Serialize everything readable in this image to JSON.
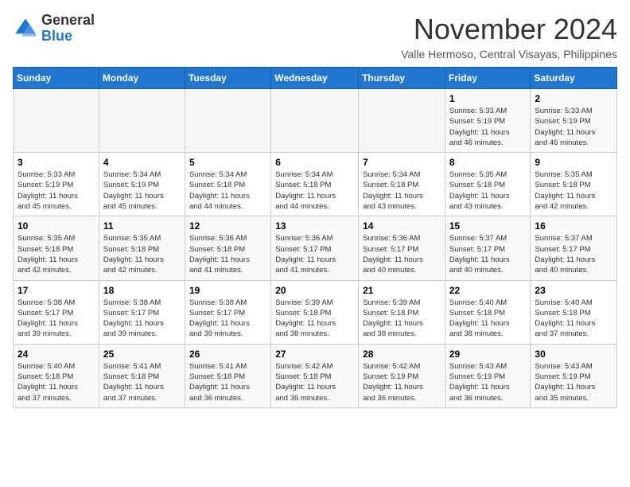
{
  "header": {
    "logo_general": "General",
    "logo_blue": "Blue",
    "month": "November 2024",
    "location": "Valle Hermoso, Central Visayas, Philippines"
  },
  "days_of_week": [
    "Sunday",
    "Monday",
    "Tuesday",
    "Wednesday",
    "Thursday",
    "Friday",
    "Saturday"
  ],
  "weeks": [
    [
      {
        "day": "",
        "info": ""
      },
      {
        "day": "",
        "info": ""
      },
      {
        "day": "",
        "info": ""
      },
      {
        "day": "",
        "info": ""
      },
      {
        "day": "",
        "info": ""
      },
      {
        "day": "1",
        "info": "Sunrise: 5:33 AM\nSunset: 5:19 PM\nDaylight: 11 hours\nand 46 minutes."
      },
      {
        "day": "2",
        "info": "Sunrise: 5:33 AM\nSunset: 5:19 PM\nDaylight: 11 hours\nand 46 minutes."
      }
    ],
    [
      {
        "day": "3",
        "info": "Sunrise: 5:33 AM\nSunset: 5:19 PM\nDaylight: 11 hours\nand 45 minutes."
      },
      {
        "day": "4",
        "info": "Sunrise: 5:34 AM\nSunset: 5:19 PM\nDaylight: 11 hours\nand 45 minutes."
      },
      {
        "day": "5",
        "info": "Sunrise: 5:34 AM\nSunset: 5:18 PM\nDaylight: 11 hours\nand 44 minutes."
      },
      {
        "day": "6",
        "info": "Sunrise: 5:34 AM\nSunset: 5:18 PM\nDaylight: 11 hours\nand 44 minutes."
      },
      {
        "day": "7",
        "info": "Sunrise: 5:34 AM\nSunset: 5:18 PM\nDaylight: 11 hours\nand 43 minutes."
      },
      {
        "day": "8",
        "info": "Sunrise: 5:35 AM\nSunset: 5:18 PM\nDaylight: 11 hours\nand 43 minutes."
      },
      {
        "day": "9",
        "info": "Sunrise: 5:35 AM\nSunset: 5:18 PM\nDaylight: 11 hours\nand 42 minutes."
      }
    ],
    [
      {
        "day": "10",
        "info": "Sunrise: 5:35 AM\nSunset: 5:18 PM\nDaylight: 11 hours\nand 42 minutes."
      },
      {
        "day": "11",
        "info": "Sunrise: 5:35 AM\nSunset: 5:18 PM\nDaylight: 11 hours\nand 42 minutes."
      },
      {
        "day": "12",
        "info": "Sunrise: 5:36 AM\nSunset: 5:18 PM\nDaylight: 11 hours\nand 41 minutes."
      },
      {
        "day": "13",
        "info": "Sunrise: 5:36 AM\nSunset: 5:17 PM\nDaylight: 11 hours\nand 41 minutes."
      },
      {
        "day": "14",
        "info": "Sunrise: 5:36 AM\nSunset: 5:17 PM\nDaylight: 11 hours\nand 40 minutes."
      },
      {
        "day": "15",
        "info": "Sunrise: 5:37 AM\nSunset: 5:17 PM\nDaylight: 11 hours\nand 40 minutes."
      },
      {
        "day": "16",
        "info": "Sunrise: 5:37 AM\nSunset: 5:17 PM\nDaylight: 11 hours\nand 40 minutes."
      }
    ],
    [
      {
        "day": "17",
        "info": "Sunrise: 5:38 AM\nSunset: 5:17 PM\nDaylight: 11 hours\nand 39 minutes."
      },
      {
        "day": "18",
        "info": "Sunrise: 5:38 AM\nSunset: 5:17 PM\nDaylight: 11 hours\nand 39 minutes."
      },
      {
        "day": "19",
        "info": "Sunrise: 5:38 AM\nSunset: 5:17 PM\nDaylight: 11 hours\nand 39 minutes."
      },
      {
        "day": "20",
        "info": "Sunrise: 5:39 AM\nSunset: 5:18 PM\nDaylight: 11 hours\nand 38 minutes."
      },
      {
        "day": "21",
        "info": "Sunrise: 5:39 AM\nSunset: 5:18 PM\nDaylight: 11 hours\nand 38 minutes."
      },
      {
        "day": "22",
        "info": "Sunrise: 5:40 AM\nSunset: 5:18 PM\nDaylight: 11 hours\nand 38 minutes."
      },
      {
        "day": "23",
        "info": "Sunrise: 5:40 AM\nSunset: 5:18 PM\nDaylight: 11 hours\nand 37 minutes."
      }
    ],
    [
      {
        "day": "24",
        "info": "Sunrise: 5:40 AM\nSunset: 5:18 PM\nDaylight: 11 hours\nand 37 minutes."
      },
      {
        "day": "25",
        "info": "Sunrise: 5:41 AM\nSunset: 5:18 PM\nDaylight: 11 hours\nand 37 minutes."
      },
      {
        "day": "26",
        "info": "Sunrise: 5:41 AM\nSunset: 5:18 PM\nDaylight: 11 hours\nand 36 minutes."
      },
      {
        "day": "27",
        "info": "Sunrise: 5:42 AM\nSunset: 5:18 PM\nDaylight: 11 hours\nand 36 minutes."
      },
      {
        "day": "28",
        "info": "Sunrise: 5:42 AM\nSunset: 5:19 PM\nDaylight: 11 hours\nand 36 minutes."
      },
      {
        "day": "29",
        "info": "Sunrise: 5:43 AM\nSunset: 5:19 PM\nDaylight: 11 hours\nand 36 minutes."
      },
      {
        "day": "30",
        "info": "Sunrise: 5:43 AM\nSunset: 5:19 PM\nDaylight: 11 hours\nand 35 minutes."
      }
    ]
  ]
}
